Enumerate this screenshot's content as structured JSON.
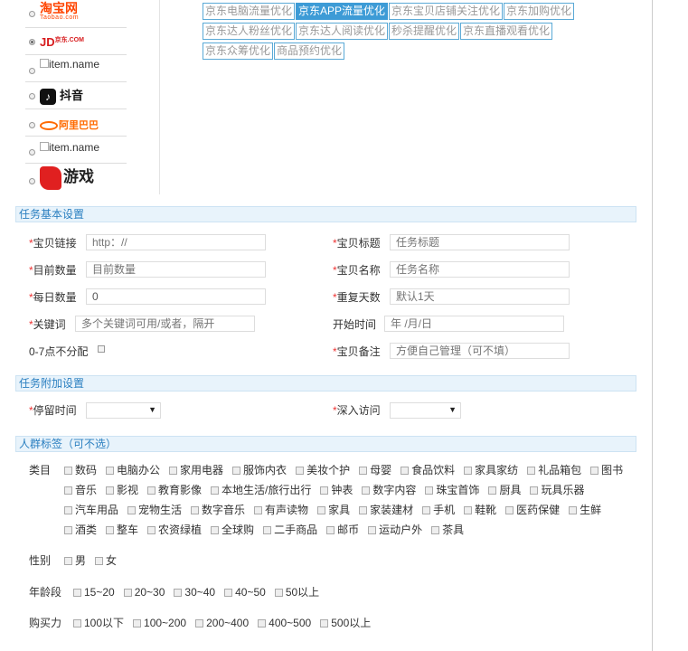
{
  "platforms": [
    {
      "name": "taobao",
      "text": "淘宝网",
      "sub": "Taobao.com",
      "checked": false
    },
    {
      "name": "jd",
      "text": "JD",
      "sub": "京东.COM",
      "checked": true
    },
    {
      "name": "broken-1",
      "text": "item.name",
      "checked": false
    },
    {
      "name": "douyin",
      "text": "抖音",
      "checked": false
    },
    {
      "name": "alibaba",
      "text": "阿里巴巴",
      "sub": "Alibaba.com",
      "checked": false
    },
    {
      "name": "broken-2",
      "text": "item.name",
      "checked": false
    },
    {
      "name": "game",
      "text": "游戏",
      "checked": false
    }
  ],
  "options": [
    [
      {
        "label": "京东电脑流量优化",
        "active": false
      },
      {
        "label": "京东APP流量优化",
        "active": true
      },
      {
        "label": "京东宝贝店铺关注优化",
        "active": false
      },
      {
        "label": "京东加购优化",
        "active": false
      }
    ],
    [
      {
        "label": "京东达人粉丝优化",
        "active": false
      },
      {
        "label": "京东达人阅读优化",
        "active": false
      },
      {
        "label": "秒杀提醒优化",
        "active": false
      },
      {
        "label": "京东直播观看优化",
        "active": false
      }
    ],
    [
      {
        "label": "京东众筹优化",
        "active": false
      },
      {
        "label": "商品预约优化",
        "active": false
      }
    ]
  ],
  "sections": {
    "basic": "任务基本设置",
    "extra": "任务附加设置",
    "crowd": "人群标签（可不选）"
  },
  "form": {
    "item_link": {
      "label": "宝贝链接",
      "placeholder": "http：//"
    },
    "item_title": {
      "label": "宝贝标题",
      "placeholder": "任务标题"
    },
    "target_qty": {
      "label": "目前数量",
      "placeholder": "目前数量"
    },
    "item_name": {
      "label": "宝贝名称",
      "placeholder": "任务名称"
    },
    "daily_qty": {
      "label": "每日数量",
      "value": "0"
    },
    "repeat_days": {
      "label": "重复天数",
      "placeholder": "默认1天"
    },
    "keyword": {
      "label": "关键词",
      "placeholder": "多个关键词可用/或者，隔开"
    },
    "start_time": {
      "label": "开始时间",
      "placeholder": "年 /月/日"
    },
    "no_dist": {
      "label": "0-7点不分配"
    },
    "item_note": {
      "label": "宝贝备注",
      "placeholder": "方便自己管理（可不填）"
    },
    "stay_time": {
      "label": "停留时间"
    },
    "deep_visit": {
      "label": "深入访问"
    }
  },
  "crowd": {
    "category_label": "类目",
    "category_rows": [
      [
        "数码",
        "电脑办公",
        "家用电器",
        "服饰内衣",
        "美妆个护",
        "母婴",
        "食品饮料",
        "家具家纺",
        "礼品箱包",
        "图书"
      ],
      [
        "音乐",
        "影视",
        "教育影像",
        "本地生活/旅行出行",
        "钟表",
        "数字内容",
        "珠宝首饰",
        "厨具",
        "玩具乐器"
      ],
      [
        "汽车用品",
        "宠物生活",
        "数字音乐",
        "有声读物",
        "家具",
        "家装建材",
        "手机",
        "鞋靴",
        "医药保健",
        "生鲜"
      ],
      [
        "酒类",
        "整车",
        "农资绿植",
        "全球购",
        "二手商品",
        "邮币",
        "运动户外",
        "茶具"
      ]
    ],
    "gender_label": "性别",
    "genders": [
      "男",
      "女"
    ],
    "age_label": "年龄段",
    "ages": [
      "15~20",
      "20~30",
      "30~40",
      "40~50",
      "50以上"
    ],
    "power_label": "购买力",
    "powers": [
      "100以下",
      "100~200",
      "200~400",
      "400~500",
      "500以上"
    ]
  }
}
